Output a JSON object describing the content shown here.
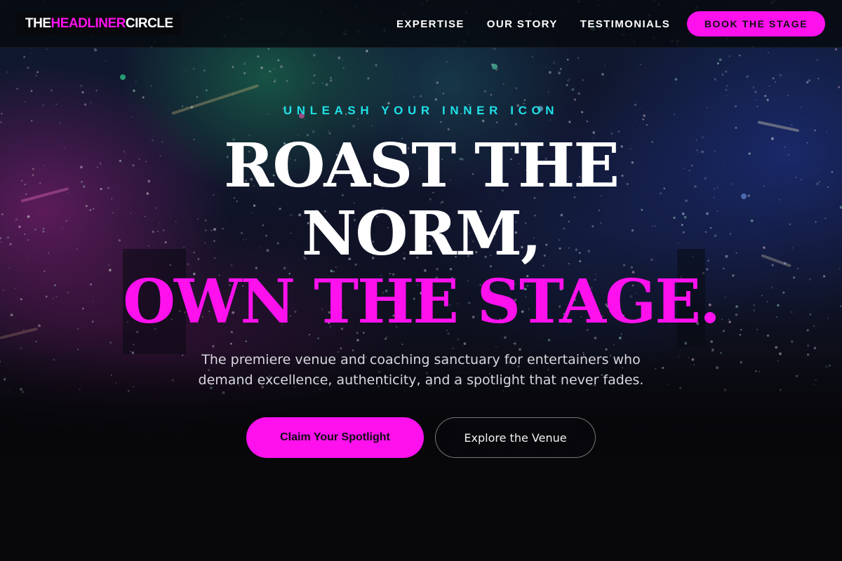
{
  "brand": {
    "logo_part1": "THE ",
    "logo_part2": "HEADLINER",
    "logo_part3": " CIRCLE"
  },
  "nav": {
    "links": [
      "EXPERTISE",
      "OUR STORY",
      "TESTIMONIALS"
    ],
    "cta_label": "BOOK THE STAGE"
  },
  "hero": {
    "eyebrow": "UNLEASH YOUR INNER ICON",
    "headline_line1": "ROAST THE",
    "headline_line2": "NORM,",
    "headline_line3": "OWN THE STAGE.",
    "subtitle": "The premiere venue and coaching sanctuary for entertainers who demand excellence, authenticity, and a spotlight that never fades.",
    "primary_cta": "Claim Your Spotlight",
    "secondary_cta": "Explore the Venue"
  },
  "colors": {
    "accent_pink": "#ff11ee",
    "accent_cyan": "#1fe0e6",
    "nav_background": "#06080e"
  }
}
